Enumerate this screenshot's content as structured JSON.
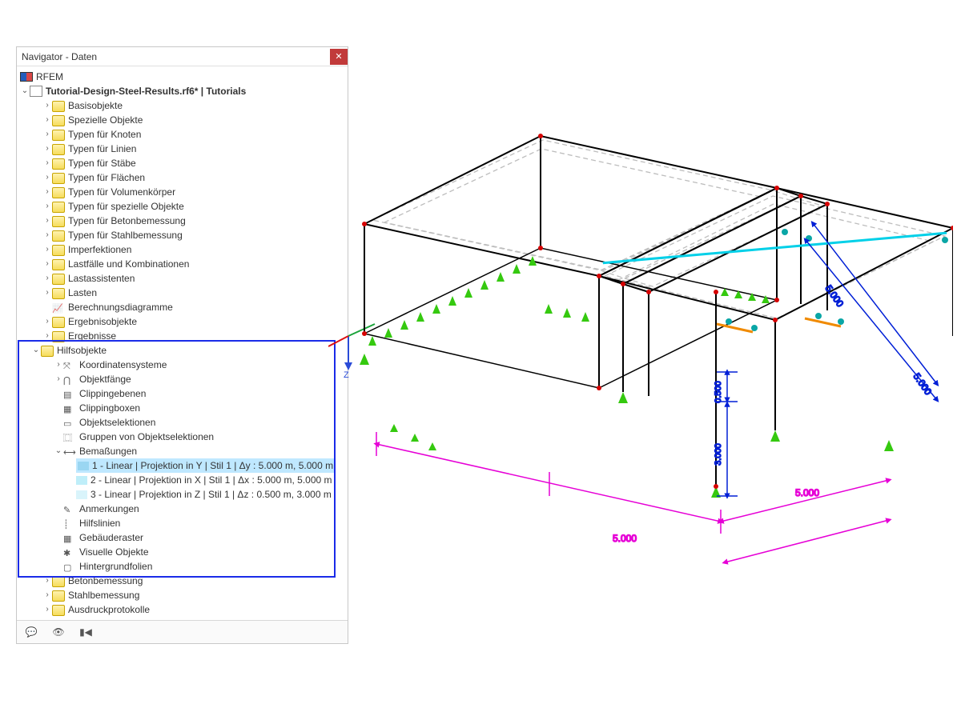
{
  "panel": {
    "title": "Navigator - Daten"
  },
  "root": {
    "rfem": "RFEM"
  },
  "project": {
    "name": "Tutorial-Design-Steel-Results.rf6* | Tutorials"
  },
  "folders": {
    "basisobjekte": "Basisobjekte",
    "spezielle": "Spezielle Objekte",
    "typen_knoten": "Typen für Knoten",
    "typen_linien": "Typen für Linien",
    "typen_staebe": "Typen für Stäbe",
    "typen_flaechen": "Typen für Flächen",
    "typen_volumen": "Typen für Volumenkörper",
    "typen_spezielle": "Typen für spezielle Objekte",
    "typen_beton": "Typen für Betonbemessung",
    "typen_stahl": "Typen für Stahlbemessung",
    "imperfektionen": "Imperfektionen",
    "lastfaelle": "Lastfälle und Kombinationen",
    "lastassistenten": "Lastassistenten",
    "lasten": "Lasten",
    "berechnungsdiagramme": "Berechnungsdiagramme",
    "ergebnisobjekte": "Ergebnisobjekte",
    "ergebnisse": "Ergebnisse",
    "hilfsobjekte": "Hilfsobjekte",
    "koordinatensysteme": "Koordinatensysteme",
    "objektfaenge": "Objektfänge",
    "clippingebenen": "Clippingebenen",
    "clippingboxen": "Clippingboxen",
    "objektselektionen": "Objektselektionen",
    "gruppen_objsel": "Gruppen von Objektselektionen",
    "bemassungen": "Bemaßungen",
    "bem1": "1 - Linear | Projektion in Y | Stil 1 | Δy : 5.000 m, 5.000 m",
    "bem2": "2 - Linear | Projektion in X | Stil 1 | Δx : 5.000 m, 5.000 m",
    "bem3": "3 - Linear | Projektion in Z | Stil 1 | Δz : 0.500 m, 3.000 m",
    "anmerkungen": "Anmerkungen",
    "hilfslinien": "Hilfslinien",
    "gebaederaster": "Gebäuderaster",
    "visuelle_objekte": "Visuelle Objekte",
    "hintergrundfolien": "Hintergrundfolien",
    "betonbemessung": "Betonbemessung",
    "stahlbemessung": "Stahlbemessung",
    "ausdruckprotokolle": "Ausdruckprotokolle"
  },
  "dimensions": {
    "d5a": "5.000",
    "d5b": "5.000",
    "d5c": "5.000",
    "d5d": "5.000",
    "d3": "3.000",
    "d05": "0.500"
  },
  "axis": {
    "z": "Z"
  },
  "colors": {
    "swatch1": "#9ad6f2",
    "swatch2": "#bfeef9",
    "swatch3": "#d9f4fb"
  }
}
